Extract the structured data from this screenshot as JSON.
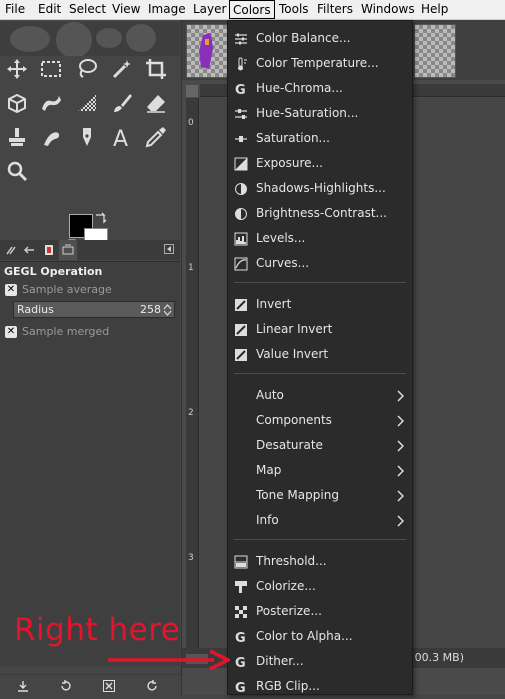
{
  "menubar": {
    "items": [
      {
        "label": "File"
      },
      {
        "label": "Edit"
      },
      {
        "label": "Select"
      },
      {
        "label": "View"
      },
      {
        "label": "Image"
      },
      {
        "label": "Layer"
      },
      {
        "label": "Colors"
      },
      {
        "label": "Tools"
      },
      {
        "label": "Filters"
      },
      {
        "label": "Windows"
      },
      {
        "label": "Help"
      }
    ],
    "active": "Colors"
  },
  "toolbox": {
    "tools": [
      {
        "icon": "move-tool-icon"
      },
      {
        "icon": "rectangle-select-icon"
      },
      {
        "icon": "lasso-select-icon"
      },
      {
        "icon": "fuzzy-select-icon"
      },
      {
        "icon": "crop-tool-icon"
      },
      {
        "icon": "unified-transform-icon"
      },
      {
        "icon": "warp-transform-icon"
      },
      {
        "icon": "gradient-tool-icon"
      },
      {
        "icon": "paintbrush-tool-icon"
      },
      {
        "icon": "eraser-tool-icon"
      },
      {
        "icon": "clone-tool-icon"
      },
      {
        "icon": "smudge-tool-icon"
      },
      {
        "icon": "paths-tool-icon"
      },
      {
        "icon": "text-tool-icon"
      },
      {
        "icon": "color-picker-icon"
      },
      {
        "icon": "zoom-tool-icon"
      }
    ],
    "fg_color": "#000000",
    "bg_color": "#ffffff"
  },
  "tool_options": {
    "title": "GEGL Operation",
    "sample_average": "Sample average",
    "radius_label": "Radius",
    "radius_value": "258",
    "sample_merged": "Sample merged",
    "check_mark": "✕"
  },
  "ruler": {
    "left_numbers": [
      "0",
      "1",
      "2",
      "3"
    ]
  },
  "status": {
    "size_text": "00.3 MB)"
  },
  "colors_menu": {
    "items": [
      {
        "label": "Color Balance...",
        "icon": "color-balance-icon"
      },
      {
        "label": "Color Temperature...",
        "icon": "color-temperature-icon"
      },
      {
        "label": "Hue-Chroma...",
        "icon": "gegl-icon"
      },
      {
        "label": "Hue-Saturation...",
        "icon": "hue-saturation-icon"
      },
      {
        "label": "Saturation...",
        "icon": "saturation-icon"
      },
      {
        "label": "Exposure...",
        "icon": "exposure-icon"
      },
      {
        "label": "Shadows-Highlights...",
        "icon": "shadows-highlights-icon"
      },
      {
        "label": "Brightness-Contrast...",
        "icon": "brightness-contrast-icon"
      },
      {
        "label": "Levels...",
        "icon": "levels-icon"
      },
      {
        "label": "Curves...",
        "icon": "curves-icon"
      },
      {
        "label": "Invert",
        "icon": "invert-icon"
      },
      {
        "label": "Linear Invert",
        "icon": "linear-invert-icon"
      },
      {
        "label": "Value Invert",
        "icon": "value-invert-icon"
      },
      {
        "label": "Auto",
        "submenu": true
      },
      {
        "label": "Components",
        "submenu": true
      },
      {
        "label": "Desaturate",
        "submenu": true
      },
      {
        "label": "Map",
        "submenu": true
      },
      {
        "label": "Tone Mapping",
        "submenu": true
      },
      {
        "label": "Info",
        "submenu": true
      },
      {
        "label": "Threshold...",
        "icon": "threshold-icon"
      },
      {
        "label": "Colorize...",
        "icon": "colorize-icon"
      },
      {
        "label": "Posterize...",
        "icon": "posterize-icon"
      },
      {
        "label": "Color to Alpha...",
        "icon": "gegl-icon"
      },
      {
        "label": "Dither...",
        "icon": "gegl-icon"
      },
      {
        "label": "RGB Clip...",
        "icon": "gegl-icon"
      }
    ]
  },
  "annotation": {
    "text": "Right here",
    "color": "#e4142c"
  }
}
